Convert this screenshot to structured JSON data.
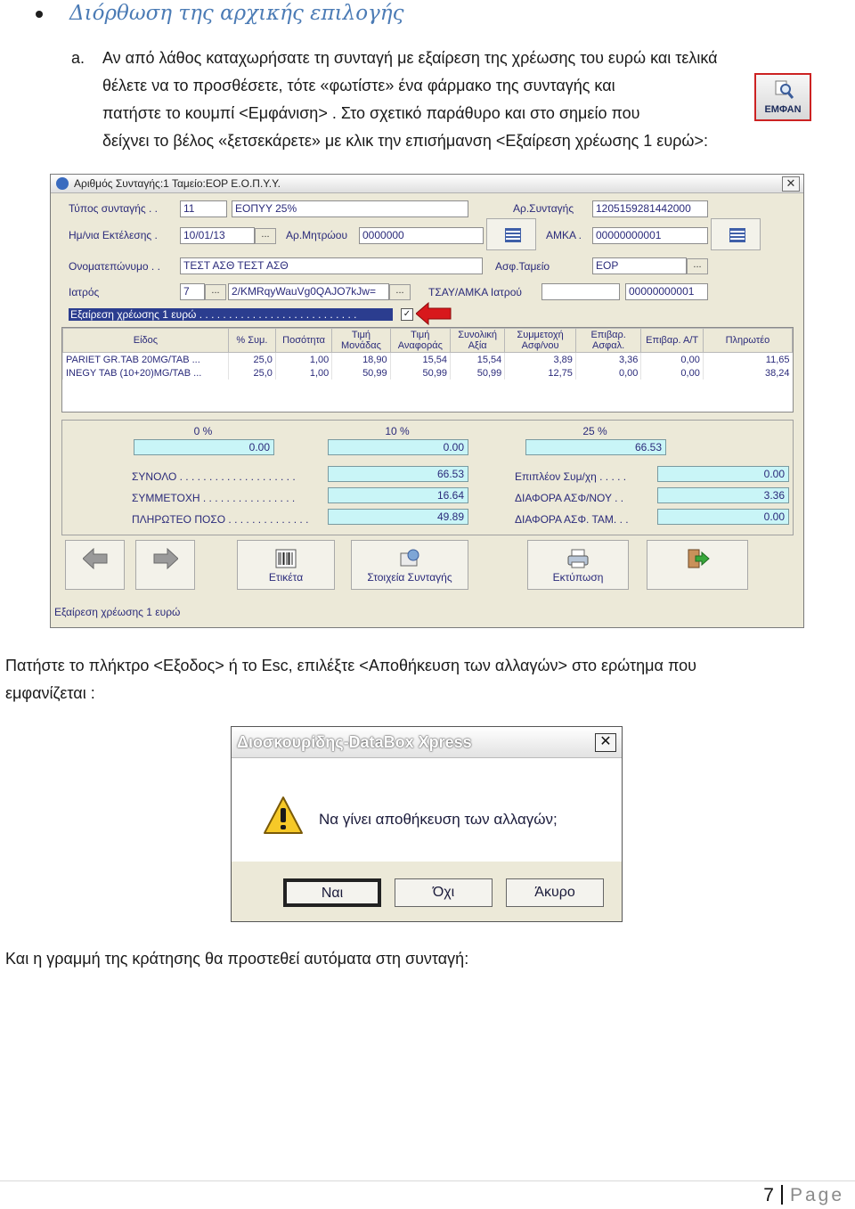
{
  "heading": "Διόρθωση της αρχικής επιλογής",
  "marker": "a.",
  "para1": [
    "Αν από λάθος καταχωρήσατε τη συνταγή με εξαίρεση της χρέωσης του ευρώ και τελικά",
    "θέλετε να το προσθέσετε, τότε «φωτίστε» ένα φάρμακο της συνταγής και",
    "πατήστε το κουμπί <Εμφάνιση> . Στο σχετικό παράθυρο και στο σημείο που",
    "δείχνει το βέλος «ξετσεκάρετε» με κλικ την επισήμανση <Εξαίρεση χρέωσης 1 ευρώ>:"
  ],
  "emfan_label": "ΕΜΦΑΝ",
  "window": {
    "title": "Αριθμός Συνταγής:1 Ταμείο:ΕΟΡ Ε.Ο.Π.Υ.Υ.",
    "labels": {
      "type": "Τύπος συνταγής . .",
      "date": "Ημ/νια Εκτέλεσης .",
      "name": "Ονοματεπώνυμο . .",
      "doctor": "Ιατρός",
      "rx_no": "Αρ.Συνταγής",
      "registry": "Αρ.Μητρώου",
      "amka": "ΑΜΚΑ .",
      "fund": "Ασφ.Ταμείο",
      "tsay": "ΤΣΑΥ/ΑΜΚΑ Ιατρού"
    },
    "values": {
      "type_code": "11",
      "type_name": "ΕΟΠΥΥ 25%",
      "rx_no": "1205159281442000",
      "date": "10/01/13",
      "registry": "0000000",
      "amka": "00000000001",
      "name": "ΤΕΣΤ ΑΣΘ ΤΕΣΤ ΑΣΘ",
      "fund": "ΕΟΡ",
      "doctor_code": "7",
      "doctor_hash": "2/KMRqyWauVg0QAJO7kJw=",
      "tsay": "",
      "tsay2": "00000000001"
    },
    "exemption_label": "Εξαίρεση χρέωσης 1 ευρώ . . . . . . . . . . . . . . . . . . . . . . . . . . .",
    "exemption_check": "✓",
    "columns": [
      "Είδος",
      "% Συμ.",
      "Ποσότητα",
      "Τιμή Μονάδας",
      "Τιμή Αναφοράς",
      "Συνολική Αξία",
      "Συμμετοχή Ασφ/νου",
      "Επιβαρ. Ασφαλ.",
      "Επιβαρ. Α/Τ",
      "Πληρωτέο"
    ],
    "rows": [
      [
        "PARIET GR.TAB 20MG/TAB ...",
        "25,0",
        "1,00",
        "18,90",
        "15,54",
        "15,54",
        "3,89",
        "3,36",
        "0,00",
        "11,65"
      ],
      [
        "INEGY TAB (10+20)MG/TAB ...",
        "25,0",
        "1,00",
        "50,99",
        "50,99",
        "50,99",
        "12,75",
        "0,00",
        "0,00",
        "38,24"
      ]
    ],
    "pct": [
      {
        "label": "0 %",
        "value": "0.00"
      },
      {
        "label": "10 %",
        "value": "0.00"
      },
      {
        "label": "25 %",
        "value": "66.53"
      }
    ],
    "totals_left": [
      {
        "label": "ΣΥΝΟΛΟ . . . . . . . . . . . . . . . . . . . .",
        "value": "66.53"
      },
      {
        "label": "ΣΥΜΜΕΤΟΧΗ . . . . . . . . . . . . . . . .",
        "value": "16.64"
      },
      {
        "label": "ΠΛΗΡΩΤΕΟ ΠΟΣΟ . . . . . . . . . . . . . .",
        "value": "49.89"
      }
    ],
    "totals_right": [
      {
        "label": "Επιπλέον Συμ/χη . . . . .",
        "value": "0.00"
      },
      {
        "label": "ΔΙΑΦΟΡΑ ΑΣΦ/ΝΟΥ . .",
        "value": "3.36"
      },
      {
        "label": "ΔΙΑΦΟΡΑ ΑΣΦ. ΤΑΜ. . .",
        "value": "0.00"
      }
    ],
    "buttons": {
      "label": "Ετικέτα",
      "details": "Στοιχεία Συνταγής",
      "print": "Εκτύπωση"
    },
    "status": "Εξαίρεση χρέωσης 1 ευρώ"
  },
  "para2": [
    "Πατήστε το πλήκτρο <Εξοδος> ή το Esc, επιλέξτε <Αποθήκευση των αλλαγών> στο ερώτημα που",
    "εμφανίζεται :"
  ],
  "dialog": {
    "title": "Διοσκουρίδης-DataBox Xpress",
    "message": "Να γίνει αποθήκευση των αλλαγών;",
    "yes": "Ναι",
    "no": "Όχι",
    "cancel": "Άκυρο"
  },
  "para3": "Και η γραμμή της κράτησης θα προστεθεί αυτόματα στη συνταγή:",
  "footer": {
    "page_number": "7",
    "page_word": "Page"
  },
  "colors": {
    "heading": "#4b7bb5",
    "selection": "#2b3d8f",
    "cyan_field": "#c9f5f7",
    "arrow": "#d8181c"
  }
}
